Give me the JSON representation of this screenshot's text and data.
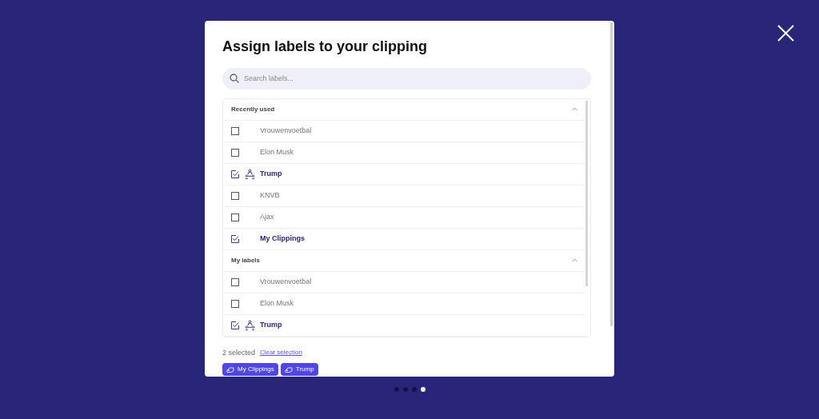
{
  "dialog": {
    "title": "Assign labels to your clipping",
    "search": {
      "placeholder": "Search labels..."
    },
    "sections": [
      {
        "title": "Recently used",
        "expanded": true,
        "items": [
          {
            "label": "Vrouwenvoetbal",
            "checked": false,
            "kind": "label"
          },
          {
            "label": "Elon Musk",
            "checked": false,
            "kind": "label"
          },
          {
            "label": "Trump",
            "checked": true,
            "kind": "group"
          },
          {
            "label": "KNVB",
            "checked": false,
            "kind": "label"
          },
          {
            "label": "Ajax",
            "checked": false,
            "kind": "label"
          },
          {
            "label": "My Clippings",
            "checked": true,
            "kind": "label"
          }
        ]
      },
      {
        "title": "My labels",
        "expanded": true,
        "items": [
          {
            "label": "Vrouwenvoetbal",
            "checked": false,
            "kind": "label"
          },
          {
            "label": "Elon Musk",
            "checked": false,
            "kind": "label"
          },
          {
            "label": "Trump",
            "checked": true,
            "kind": "group"
          }
        ]
      }
    ],
    "selection_count": "2 selected",
    "clear_link": "Clear selection",
    "chips": [
      "My Clippings",
      "Trump"
    ]
  },
  "pager": [
    {
      "selected": false
    },
    {
      "selected": false
    },
    {
      "selected": false
    },
    {
      "selected": true
    }
  ]
}
